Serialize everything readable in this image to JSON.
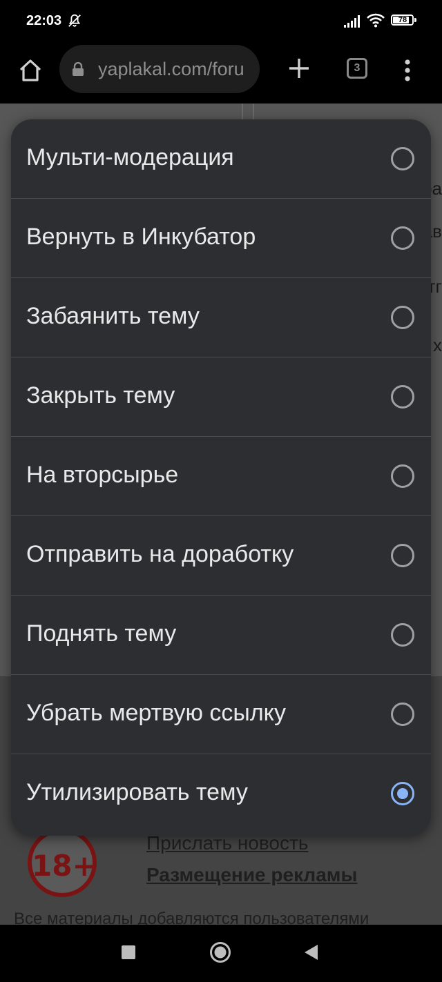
{
  "status_bar": {
    "time": "22:03",
    "battery": "78"
  },
  "browser": {
    "url": "yaplakal.com/foru",
    "tab_count": "3"
  },
  "background_page": {
    "peek_fragments": [
      "ра",
      "ав",
      "тг",
      "х"
    ],
    "badge_18": "18+",
    "link_news": "Прислать новость",
    "link_ads": "Размещение рекламы",
    "footer_text": "Все материалы добавляются пользователями"
  },
  "dialog": {
    "options": [
      {
        "label": "Мульти-модерация",
        "selected": false
      },
      {
        "label": "Вернуть в Инкубатор",
        "selected": false
      },
      {
        "label": "Забаянить тему",
        "selected": false
      },
      {
        "label": "Закрыть тему",
        "selected": false
      },
      {
        "label": "На вторсырье",
        "selected": false
      },
      {
        "label": "Отправить на доработку",
        "selected": false
      },
      {
        "label": "Поднять тему",
        "selected": false
      },
      {
        "label": "Убрать мертвую ссылку",
        "selected": false
      },
      {
        "label": "Утилизировать тему",
        "selected": true
      }
    ]
  },
  "colors": {
    "dialog_bg": "#2d2e31",
    "radio_selected": "#8ab4f8",
    "radio_unselected": "#a0a0a3"
  },
  "icons": [
    "do-not-disturb-icon",
    "signal-icon",
    "wifi-icon",
    "battery-icon",
    "home-icon",
    "lock-icon",
    "new-tab-icon",
    "tab-switcher-icon",
    "more-icon",
    "nav-recents-icon",
    "nav-home-icon",
    "nav-back-icon"
  ]
}
